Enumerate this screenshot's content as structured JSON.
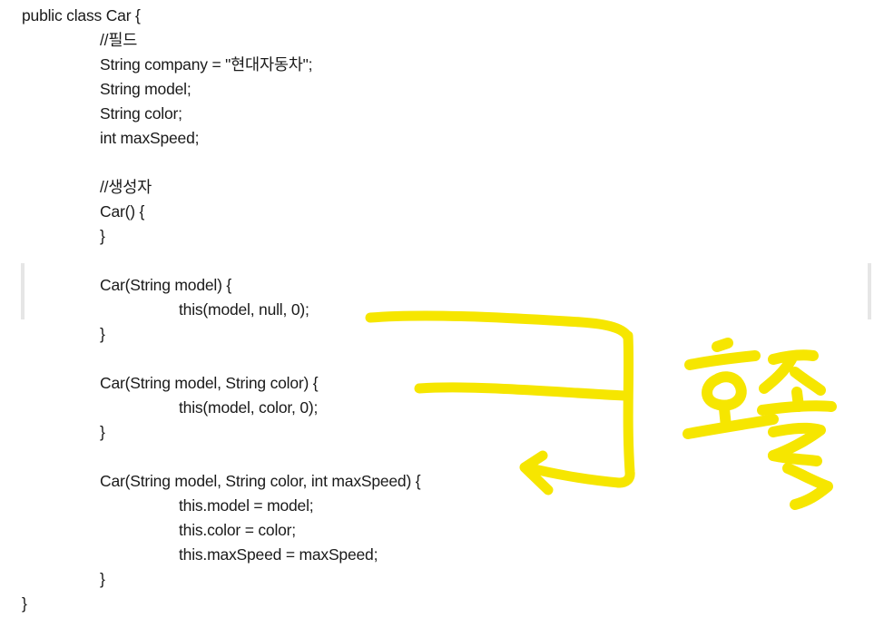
{
  "code": {
    "lines": [
      "public class Car {",
      "//필드",
      "String company = \"현대자동차\";",
      "String model;",
      "String color;",
      "int maxSpeed;",
      "",
      "//생성자",
      "Car() {",
      "}",
      "",
      "Car(String model) {",
      "this(model, null, 0);",
      "}",
      "",
      "Car(String model, String color) {",
      "this(model, color, 0);",
      "}",
      "",
      "Car(String model, String color, int maxSpeed) {",
      "this.model = model;",
      "this.color = color;",
      "this.maxSpeed = maxSpeed;",
      "}",
      "}"
    ]
  },
  "annotation": {
    "handwritten_text": "호출",
    "color": "#f6e600"
  }
}
